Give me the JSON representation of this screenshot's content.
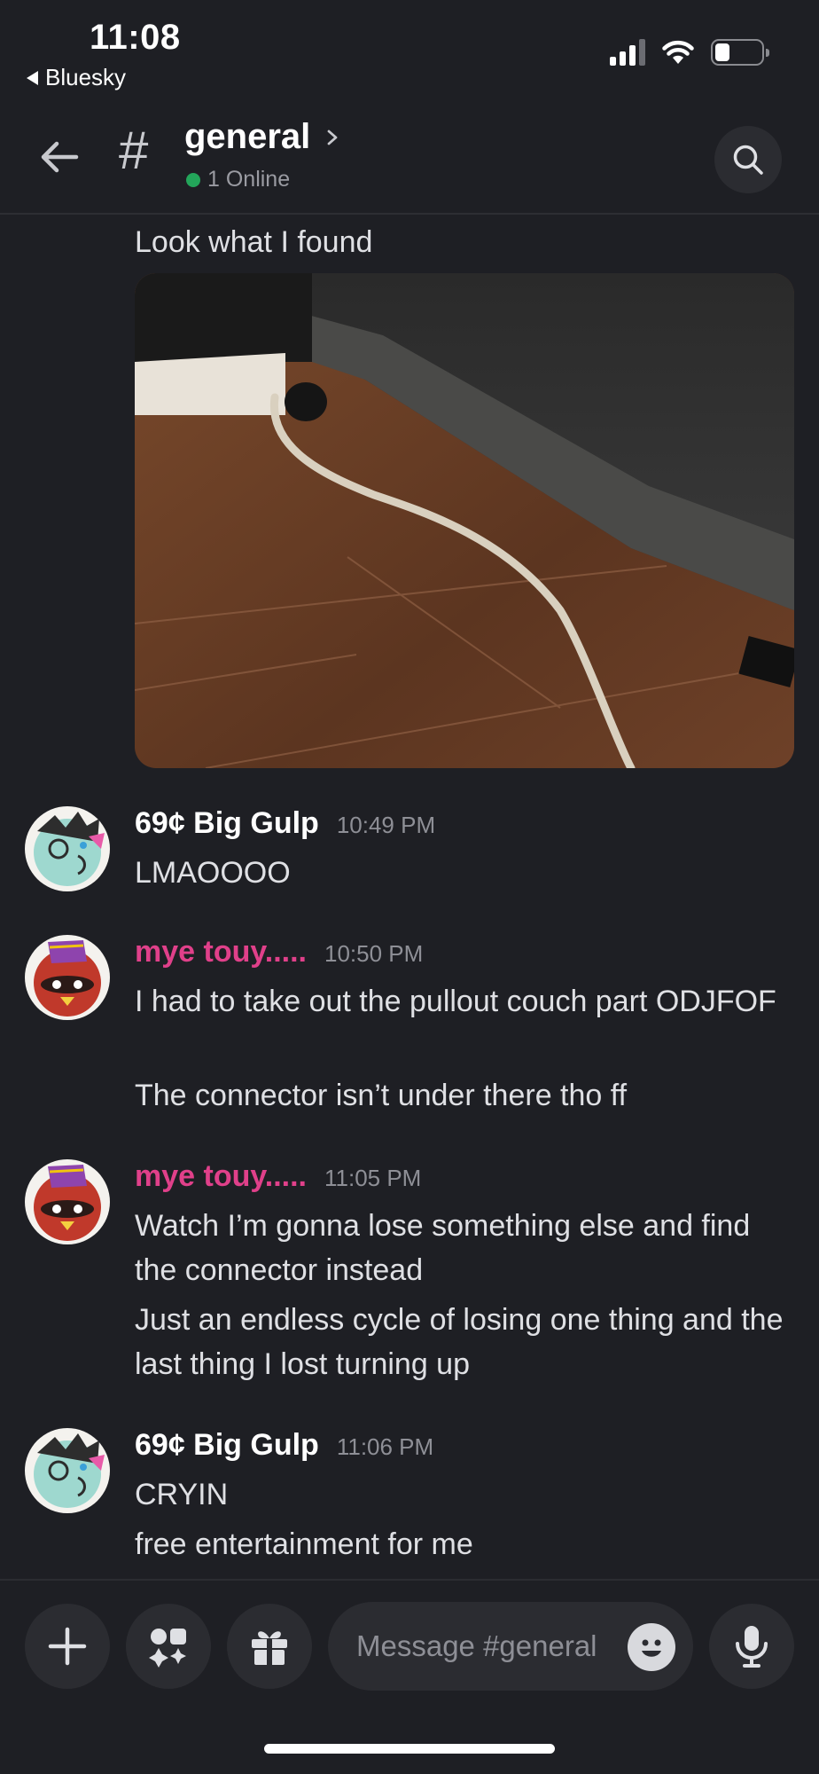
{
  "status_bar": {
    "time": "11:08",
    "back_app": "Bluesky"
  },
  "header": {
    "channel_name": "general",
    "online_text": "1 Online"
  },
  "messages": {
    "first_text": "Look what I found",
    "items": [
      {
        "author": "69¢ Big Gulp",
        "time": "10:49 PM",
        "lines": [
          "LMAOOOO"
        ]
      },
      {
        "author": "mye touy.....",
        "time": "10:50 PM",
        "lines": [
          "I had to take out the pullout couch part ODJFOF",
          "The connector isn’t under there tho ff"
        ]
      },
      {
        "author": "mye touy.....",
        "time": "11:05 PM",
        "lines": [
          "Watch I’m gonna lose something else and find the connector instead",
          "Just an endless cycle of losing one thing and the last thing I lost turning up"
        ]
      },
      {
        "author": "69¢ Big Gulp",
        "time": "11:06 PM",
        "lines": [
          "CRYIN",
          "free entertainment for me"
        ]
      }
    ]
  },
  "composer": {
    "placeholder": "Message #general"
  },
  "colors": {
    "accent_pink": "#e0408a",
    "online_green": "#23a55a",
    "background": "#1e1f24"
  }
}
